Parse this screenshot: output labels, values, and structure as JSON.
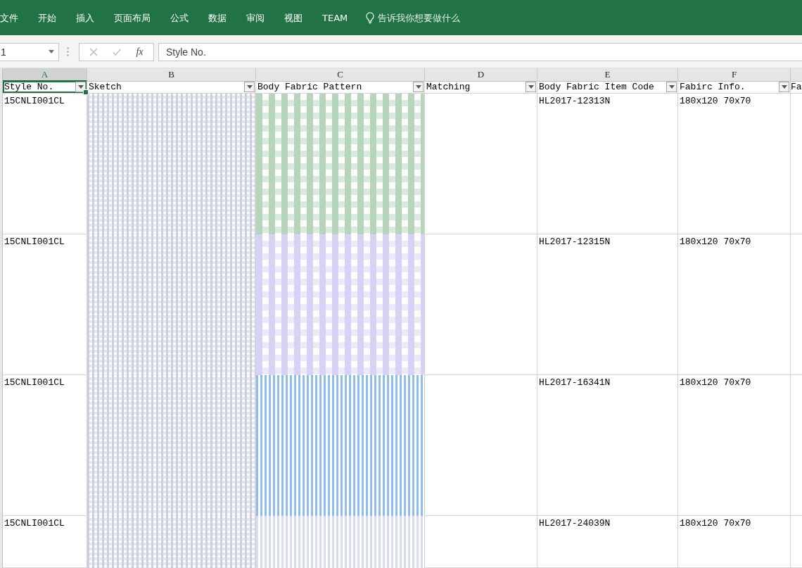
{
  "ribbon": {
    "tabs": [
      {
        "label": "文件",
        "selected": false
      },
      {
        "label": "开始",
        "selected": false
      },
      {
        "label": "插入",
        "selected": false
      },
      {
        "label": "页面布局",
        "selected": false
      },
      {
        "label": "公式",
        "selected": false
      },
      {
        "label": "数据",
        "selected": false
      },
      {
        "label": "审阅",
        "selected": false
      },
      {
        "label": "视图",
        "selected": false
      },
      {
        "label": "TEAM",
        "selected": false
      }
    ],
    "tell_me": {
      "placeholder": "告诉我你想要做什么"
    }
  },
  "formula_bar": {
    "name_box": "1",
    "buttons": [
      {
        "kind": "cancel",
        "disabled": true
      },
      {
        "kind": "enter",
        "disabled": true
      },
      {
        "kind": "function",
        "label": "fx",
        "disabled": false
      }
    ],
    "value": "Style No."
  },
  "sheet": {
    "columns": [
      {
        "letter": "A",
        "selected": true
      },
      {
        "letter": "B",
        "selected": false
      },
      {
        "letter": "C",
        "selected": false
      },
      {
        "letter": "D",
        "selected": false
      },
      {
        "letter": "E",
        "selected": false
      },
      {
        "letter": "F",
        "selected": false
      }
    ],
    "header_row": [
      {
        "text": "Style No.",
        "filter": true,
        "selected": true
      },
      {
        "text": "Sketch",
        "filter": true,
        "selected": false
      },
      {
        "text": "Body Fabric Pattern",
        "filter": true,
        "selected": false
      },
      {
        "text": "Matching",
        "filter": true,
        "selected": false
      },
      {
        "text": "Body Fabric Item Code",
        "filter": true,
        "selected": false
      },
      {
        "text": "Fabirc Info.",
        "filter": true,
        "selected": false
      },
      {
        "text": "Fa",
        "selected": false
      }
    ],
    "rows": [
      {
        "style_no": "15CNLI001CL",
        "sketch": {
          "kind": "gingham",
          "color": "#cbd1dd"
        },
        "pattern": {
          "kind": "gingham",
          "color": "#b7d5bd"
        },
        "item_code": "HL2017-12313N",
        "fabric_info": "180x120 70x70"
      },
      {
        "style_no": "15CNLI001CL",
        "sketch": {
          "kind": "gingham",
          "color": "#cbd1dd"
        },
        "pattern": {
          "kind": "gingham",
          "color": "#d8d3f6"
        },
        "item_code": "HL2017-12315N",
        "fabric_info": "180x120 70x70"
      },
      {
        "style_no": "15CNLI001CL",
        "sketch": {
          "kind": "gingham",
          "color": "#cbd1dd"
        },
        "pattern": {
          "kind": "stripes",
          "color": "#8fbcee"
        },
        "item_code": "HL2017-16341N",
        "fabric_info": "180x120 70x70"
      },
      {
        "style_no": "15CNLI001CL",
        "sketch": {
          "kind": "gingham",
          "color": "#cbd1dd"
        },
        "pattern": {
          "kind": "stripes",
          "color": "#d9dbee"
        },
        "item_code": "HL2017-24039N",
        "fabric_info": "180x120 70x70"
      }
    ]
  }
}
